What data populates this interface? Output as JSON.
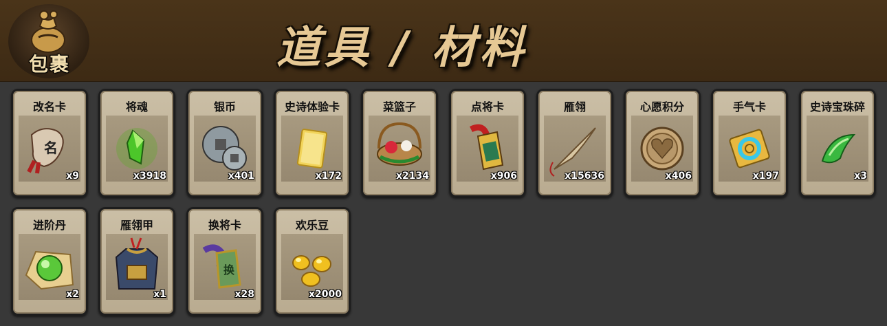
{
  "header": {
    "logo_text": "包裹",
    "title": "道具 / 材料"
  },
  "items": [
    {
      "name": "改名卡",
      "count": "x9",
      "icon": "rename-card-icon"
    },
    {
      "name": "将魂",
      "count": "x3918",
      "icon": "general-soul-icon"
    },
    {
      "name": "银币",
      "count": "x401",
      "icon": "silver-coin-icon"
    },
    {
      "name": "史诗体验卡",
      "count": "x172",
      "icon": "epic-trial-card-icon"
    },
    {
      "name": "菜篮子",
      "count": "x2134",
      "icon": "vegetable-basket-icon"
    },
    {
      "name": "点将卡",
      "count": "x906",
      "icon": "select-general-card-icon"
    },
    {
      "name": "雁翎",
      "count": "x15636",
      "icon": "feather-icon"
    },
    {
      "name": "心愿积分",
      "count": "x406",
      "icon": "wish-points-coin-icon"
    },
    {
      "name": "手气卡",
      "count": "x197",
      "icon": "luck-card-icon"
    },
    {
      "name": "史诗宝珠碎",
      "count": "x3",
      "icon": "epic-orb-shard-icon"
    },
    {
      "name": "进阶丹",
      "count": "x2",
      "icon": "advance-pill-icon"
    },
    {
      "name": "雁翎甲",
      "count": "x1",
      "icon": "feather-armor-icon"
    },
    {
      "name": "换将卡",
      "count": "x28",
      "icon": "swap-general-card-icon"
    },
    {
      "name": "欢乐豆",
      "count": "x2000",
      "icon": "happy-beans-icon"
    }
  ]
}
